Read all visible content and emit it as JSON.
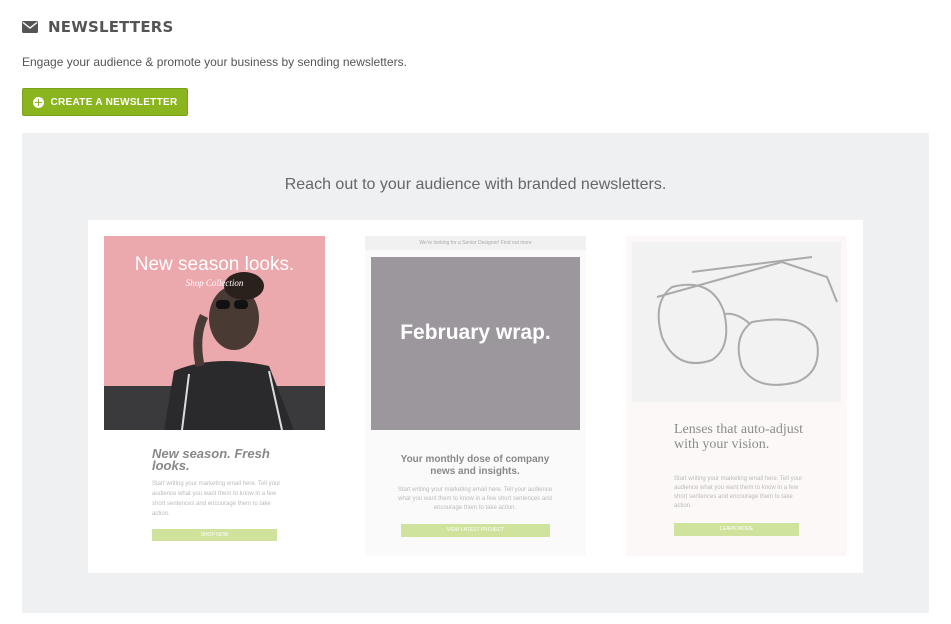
{
  "header": {
    "icon": "envelope-icon",
    "title": "NEWSLETTERS",
    "subtitle": "Engage your audience & promote your business by sending newsletters."
  },
  "create_button": {
    "icon": "plus-circle-icon",
    "label": "CREATE A NEWSLETTER",
    "color": "#8ab51f"
  },
  "promo": {
    "heading": "Reach out to your audience with branded newsletters.",
    "cards": [
      {
        "image_headline": "New season looks.",
        "image_subline": "Shop Collection",
        "title": "New season. Fresh looks.",
        "body": "Start writing your marketing email here. Tell your audience what you want them to know in a few short sentences and encourage them to take action.",
        "button": "SHOP NOW"
      },
      {
        "top_bar": "We're looking for a Senior Designer!  Find out more",
        "image_headline": "February wrap.",
        "title": "Your monthly dose of company news and insights.",
        "body": "Start writing your marketing email here. Tell your audience what you want them to know in a few short sentences and encourage them to take action.",
        "button": "VIEW LATEST PROJECT"
      },
      {
        "title": "Lenses that auto-adjust with your vision.",
        "body": "Start writing your marketing email here. Tell your audience what you want them to know in a few short sentences and encourage them to take action.",
        "button": "LEARN MORE"
      }
    ]
  }
}
